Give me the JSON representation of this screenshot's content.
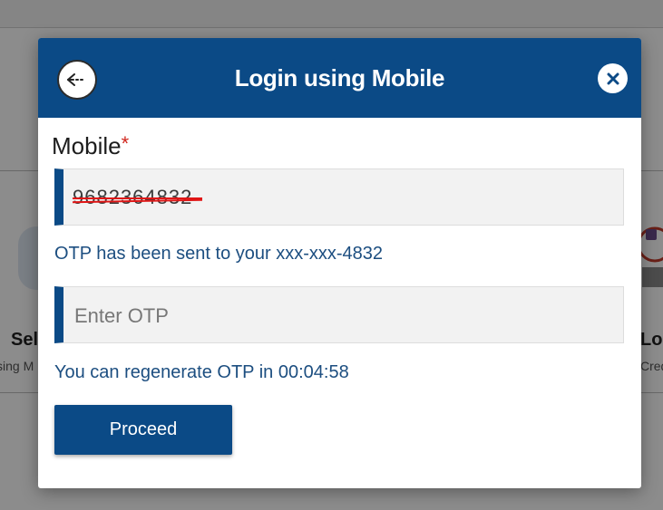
{
  "modal": {
    "title": "Login using Mobile",
    "mobile_label": "Mobile",
    "required_marker": "*",
    "mobile_value": "9682364832",
    "otp_sent_text": "OTP has been sent to your xxx-xxx-4832",
    "otp_placeholder": "Enter OTP",
    "regenerate_text": "You can regenerate OTP in 00:04:58",
    "proceed_label": "Proceed"
  },
  "background": {
    "left_card_title": "Selt",
    "left_card_sub": "sing M",
    "right_card_title": "Log",
    "right_card_sub": "Cred"
  },
  "colors": {
    "primary": "#0b4a86",
    "info_text": "#1c4e80",
    "required": "#d0261d",
    "strike": "#e01616"
  },
  "icons": {
    "back": "arrow-left-icon",
    "close": "close-icon"
  }
}
